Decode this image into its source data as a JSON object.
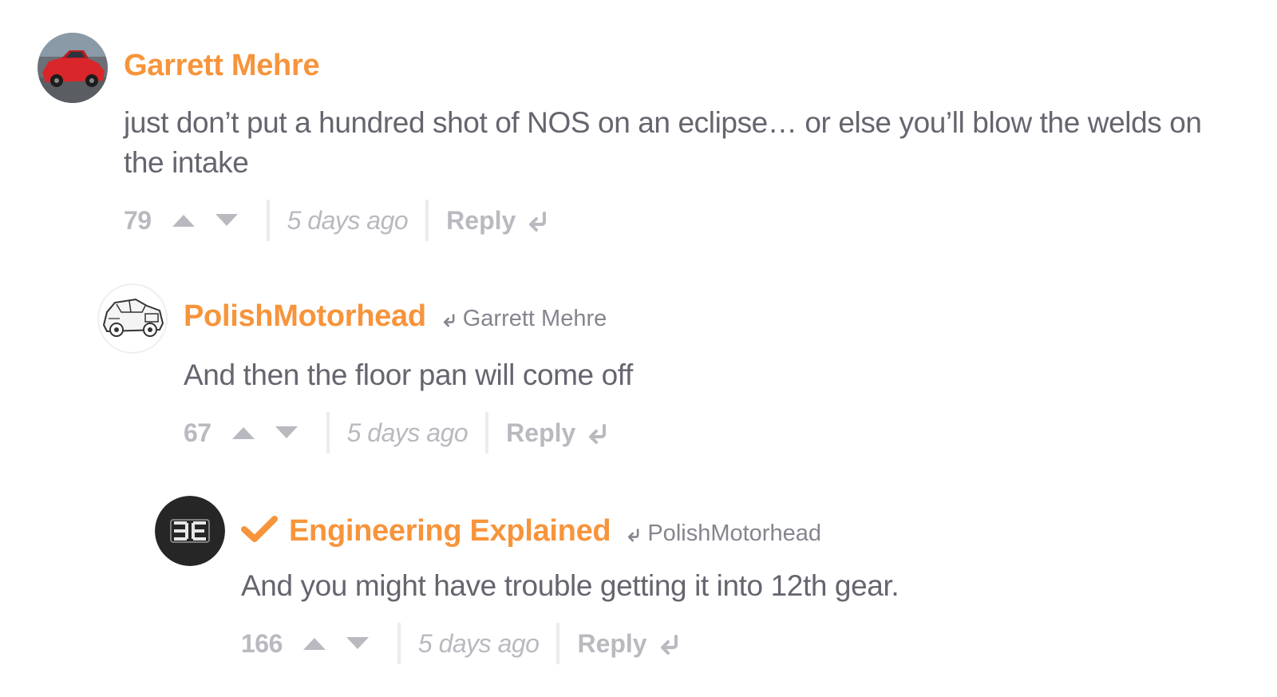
{
  "colors": {
    "author": "#f7943b",
    "text": "#65656f",
    "muted": "#b9b9c0",
    "separator": "#ececef"
  },
  "comments": [
    {
      "author": "Garrett Mehre",
      "reply_to": "",
      "verified": false,
      "text": "just don’t put a hundred shot of NOS on an eclipse… or else you’ll blow the welds on the intake",
      "score": "79",
      "time": "5 days ago",
      "reply_label": "Reply",
      "avatar_icon": "red-car-avatar-icon"
    },
    {
      "author": "PolishMotorhead",
      "reply_to": "Garrett Mehre",
      "verified": false,
      "text": "And then the floor pan will come off",
      "score": "67",
      "time": "5 days ago",
      "reply_label": "Reply",
      "avatar_icon": "car-sketch-avatar-icon"
    },
    {
      "author": "Engineering Explained",
      "reply_to": "PolishMotorhead",
      "verified": true,
      "text": "And you might have trouble getting it into 12th gear.",
      "score": "166",
      "time": "5 days ago",
      "reply_label": "Reply",
      "avatar_icon": "ee-logo-avatar-icon"
    }
  ]
}
